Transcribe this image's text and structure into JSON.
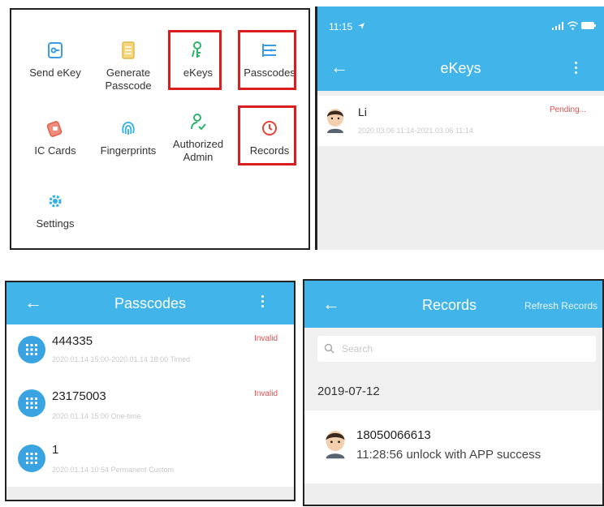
{
  "menu": {
    "items": [
      {
        "label_lines": [
          "Send eKey"
        ],
        "icon": "send-ekey-icon"
      },
      {
        "label_lines": [
          "Generate",
          "Passcode"
        ],
        "icon": "generate-passcode-icon"
      },
      {
        "label_lines": [
          "eKeys"
        ],
        "icon": "ekeys-icon"
      },
      {
        "label_lines": [
          "Passcodes"
        ],
        "icon": "passcodes-icon"
      },
      {
        "label_lines": [
          "IC Cards"
        ],
        "icon": "ic-cards-icon"
      },
      {
        "label_lines": [
          "Fingerprints"
        ],
        "icon": "fingerprints-icon"
      },
      {
        "label_lines": [
          "Authorized",
          "Admin"
        ],
        "icon": "authorized-admin-icon"
      },
      {
        "label_lines": [
          "Records"
        ],
        "icon": "records-icon"
      },
      {
        "label_lines": [
          "Settings"
        ],
        "icon": "settings-icon"
      }
    ],
    "highlight_color": "#d81e1e"
  },
  "ekeys_screen": {
    "status_time": "11:15",
    "title": "eKeys",
    "entry": {
      "name": "Li",
      "status": "Pending...",
      "period": "2020.03.06 11:14-2021.03.06 11:14"
    }
  },
  "passcodes_screen": {
    "title": "Passcodes",
    "items": [
      {
        "code": "444335",
        "status": "Invalid",
        "detail": "2020.01.14 15:00-2020.01.14 18:00   Timed"
      },
      {
        "code": "23175003",
        "status": "Invalid",
        "detail": "2020.01.14 15:00   One-time"
      },
      {
        "code": "1",
        "status": "",
        "detail": "2020.01.14 10:54   Permanent   Custom"
      }
    ]
  },
  "records_screen": {
    "title": "Records",
    "refresh_label": "Refresh Records",
    "search_placeholder": "Search",
    "date_header": "2019-07-12",
    "record": {
      "user": "18050066613",
      "event": "11:28:56 unlock with APP success"
    }
  },
  "colors": {
    "accent": "#41b4e9",
    "status_red": "#e05050",
    "list_icon": "#3aa4e3"
  }
}
